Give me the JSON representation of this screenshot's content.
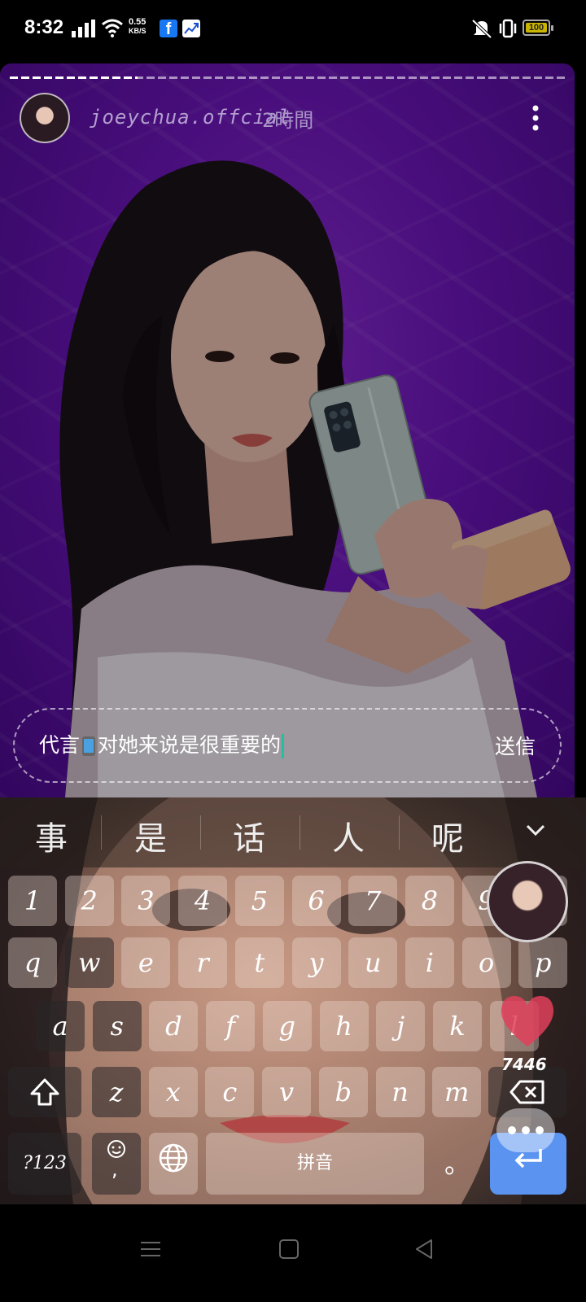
{
  "status_bar": {
    "time": "8:32",
    "net_speed_value": "0.55",
    "net_speed_unit": "KB/S",
    "facebook_glyph": "f",
    "battery": "100"
  },
  "story": {
    "username": "joeychua.offcial",
    "time_ago": "2時間",
    "progress_fraction": 0.23
  },
  "reply": {
    "text_before_icon": "代言",
    "text_after_icon": "对她来说是很重要的",
    "send_label": "送信"
  },
  "candidates": [
    "事",
    "是",
    "话",
    "人",
    "呢"
  ],
  "keyboard": {
    "row_numbers": [
      "1",
      "2",
      "3",
      "4",
      "5",
      "6",
      "7",
      "8",
      "9",
      "0"
    ],
    "row_top": [
      "q",
      "w",
      "e",
      "r",
      "t",
      "y",
      "u",
      "i",
      "o",
      "p"
    ],
    "row_mid": [
      "a",
      "s",
      "d",
      "f",
      "g",
      "h",
      "j",
      "k",
      "l"
    ],
    "row_bottom": [
      "z",
      "x",
      "c",
      "v",
      "b",
      "n",
      "m"
    ],
    "symbols_label": "?123",
    "comma_label": ",",
    "space_label": "拼音",
    "period_label": "。"
  },
  "likes_count": "7446",
  "colors": {
    "story_bg": "#6a15b6",
    "enter_key": "#5a93f0",
    "caret": "#20c0a0",
    "heart": "#e0405a",
    "battery_fill": "#c9b400"
  }
}
